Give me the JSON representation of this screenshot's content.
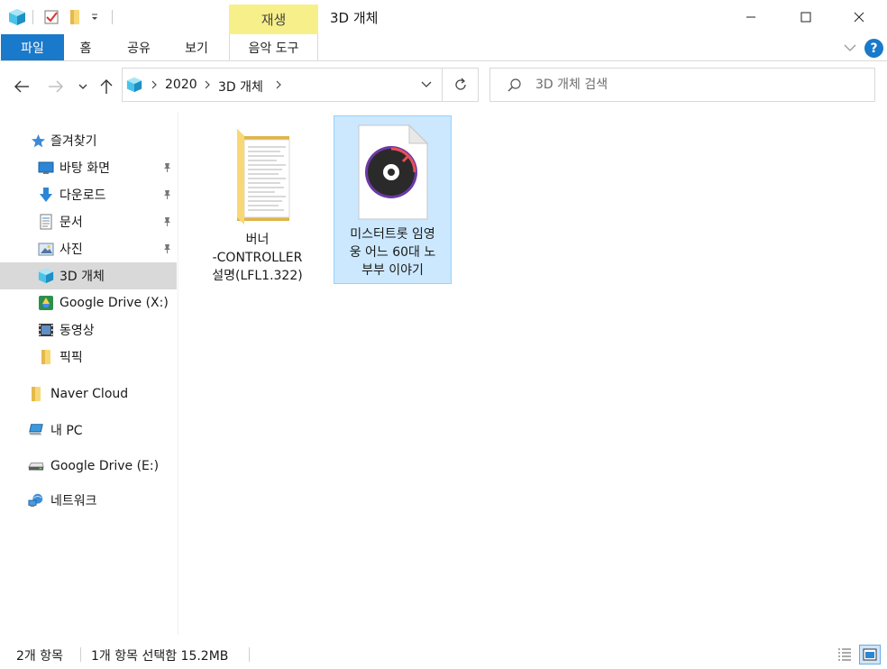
{
  "titlebar": {
    "title": "3D 개체",
    "context_tab_header": "재생",
    "icons": [
      "3d-objects-icon",
      "properties-check-icon",
      "new-folder-icon",
      "qat-dropdown-icon"
    ],
    "window_buttons": [
      "minimize",
      "maximize",
      "close"
    ]
  },
  "ribbon": {
    "tabs": [
      {
        "label": "파일"
      },
      {
        "label": "홈"
      },
      {
        "label": "공유"
      },
      {
        "label": "보기"
      },
      {
        "label": "음악 도구"
      }
    ]
  },
  "nav": {
    "breadcrumbs": [
      "2020",
      "3D 개체"
    ],
    "search_placeholder": "3D 개체 검색"
  },
  "sidebar": {
    "items": [
      {
        "label": "즐겨찾기",
        "icon": "star-icon"
      },
      {
        "label": "바탕 화면",
        "icon": "desktop-icon",
        "pinned": true
      },
      {
        "label": "다운로드",
        "icon": "download-icon",
        "pinned": true
      },
      {
        "label": "문서",
        "icon": "document-icon",
        "pinned": true
      },
      {
        "label": "사진",
        "icon": "pictures-icon",
        "pinned": true
      },
      {
        "label": "3D 개체",
        "icon": "3d-objects-icon",
        "selected": true
      },
      {
        "label": "Google Drive (X:)",
        "icon": "google-drive-icon"
      },
      {
        "label": "동영상",
        "icon": "video-icon"
      },
      {
        "label": "픽픽",
        "icon": "folder-icon"
      },
      {
        "label": "Naver Cloud",
        "icon": "folder-icon"
      },
      {
        "label": "내 PC",
        "icon": "pc-icon"
      },
      {
        "label": "Google Drive (E:)",
        "icon": "drive-icon"
      },
      {
        "label": "네트워크",
        "icon": "network-icon"
      }
    ]
  },
  "files": [
    {
      "name_lines": [
        "버너",
        "-CONTROLLER",
        "설명(LFL1.322)"
      ],
      "type": "folder",
      "selected": false
    },
    {
      "name_lines": [
        "미스터트롯 임영",
        "웅 어느 60대 노",
        "부부 이야기"
      ],
      "type": "audio",
      "selected": true
    }
  ],
  "status": {
    "item_count": "2개 항목",
    "selection": "1개 항목 선택함 15.2MB"
  },
  "colors": {
    "accent": "#1979ca",
    "context_tab": "#f7f08a",
    "selection_bg": "#cce8ff",
    "selection_border": "#99d1ff",
    "sidebar_selected": "#d9d9d9"
  }
}
